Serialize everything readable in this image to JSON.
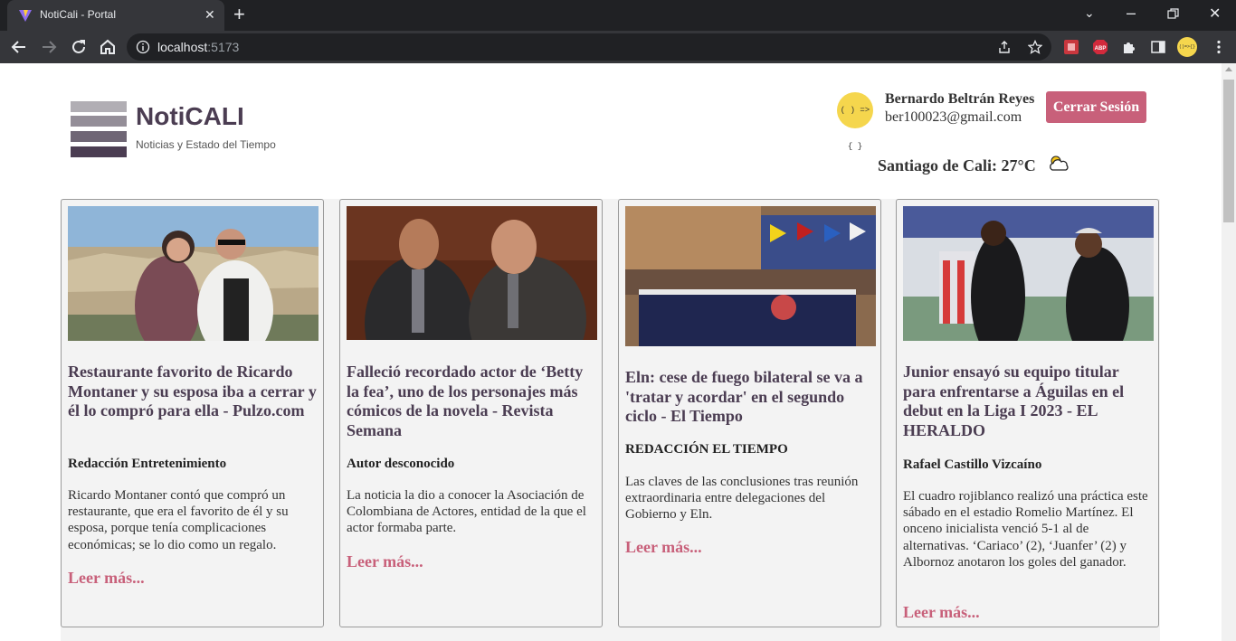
{
  "browser": {
    "tab_title": "NotiCali - Portal",
    "new_tab_icon": "plus-icon",
    "url_host": "localhost",
    "url_port": ":5173"
  },
  "header": {
    "brand": "NotiCALI",
    "tagline": "Noticias y Estado del Tiempo",
    "avatar_text": "( ) => { }",
    "user_name": "Bernardo Beltrán Reyes",
    "user_email": "ber100023@gmail.com",
    "logout_label": "Cerrar Sesión",
    "weather": "Santiago de Cali: 27°C",
    "weather_icon": "partly-cloudy-icon"
  },
  "colors": {
    "accent": "#c8607a",
    "title": "#4b3d52",
    "card_bg": "#f3f3f3"
  },
  "news": [
    {
      "title": "Restaurante favorito de Ricardo Montaner y su esposa iba a cerrar y él lo compró para ella - Pulzo.com",
      "author": "Redacción Entretenimiento",
      "description": "Ricardo Montaner contó que compró un restaurante, que era el favorito de él y su esposa, porque tenía complicaciones económicas; se lo dio como un regalo.",
      "more": "Leer más..."
    },
    {
      "title": "Falleció recordado actor de ‘Betty la fea’, uno de los personajes más cómicos de la novela - Revista Semana",
      "author": "Autor desconocido",
      "description": "La noticia la dio a conocer la Asociación de Colombiana de Actores, entidad de la que el actor formaba parte.",
      "more": "Leer más..."
    },
    {
      "title": "Eln: cese de fuego bilateral se va a 'tratar y acordar' en el segundo ciclo - El Tiempo",
      "author": "REDACCIÓN EL TIEMPO",
      "description": "Las claves de las conclusiones tras reunión extraordinaria entre delegaciones del Gobierno y Eln.",
      "more": "Leer más..."
    },
    {
      "title": "Junior ensayó su equipo titular para enfrentarse a Águilas en el debut en la Liga I 2023 - EL HERALDO",
      "author": "Rafael Castillo Vizcaíno",
      "description": "El cuadro rojiblanco realizó una práctica este sábado en el estadio Romelio Martínez. El onceno inicialista venció 5-1 al de alternativas. ‘Cariaco’ (2), ‘Juanfer’ (2) y Albornoz anotaron los goles del ganador.",
      "more": "Leer más..."
    }
  ]
}
